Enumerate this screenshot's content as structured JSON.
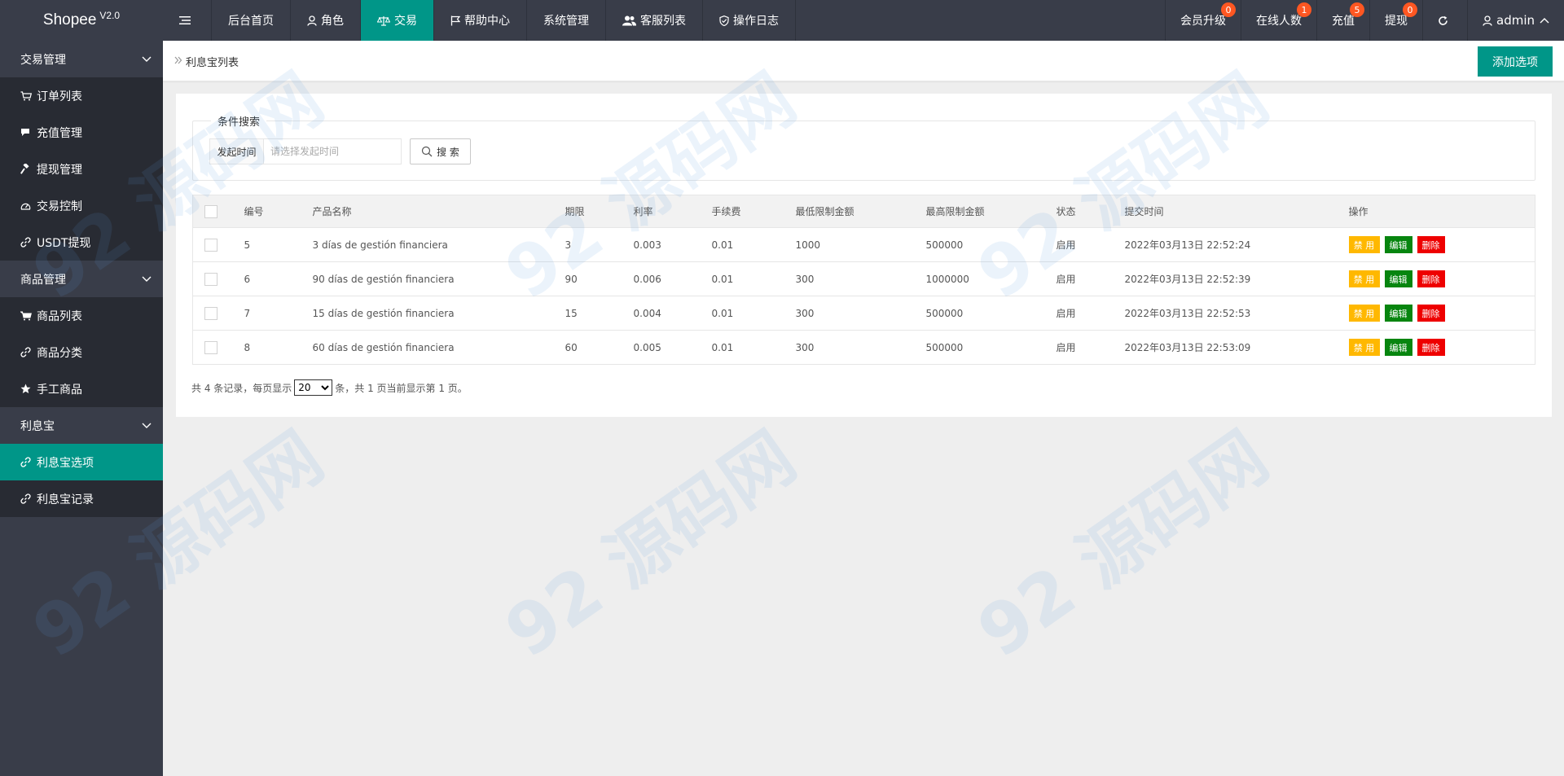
{
  "header": {
    "logo": "Shopee",
    "version": "V2.0",
    "nav": [
      {
        "label": "后台首页",
        "icon": "none"
      },
      {
        "label": "角色",
        "icon": "user-icon"
      },
      {
        "label": "交易",
        "icon": "scale-icon",
        "active": true
      },
      {
        "label": "帮助中心",
        "icon": "flag-icon"
      },
      {
        "label": "系统管理",
        "icon": "none"
      },
      {
        "label": "客服列表",
        "icon": "users-icon"
      },
      {
        "label": "操作日志",
        "icon": "shield-icon"
      }
    ],
    "right": [
      {
        "label": "会员升级",
        "badge": "0"
      },
      {
        "label": "在线人数",
        "badge": "1"
      },
      {
        "label": "充值",
        "badge": "5"
      },
      {
        "label": "提现",
        "badge": "0"
      }
    ],
    "user": "admin",
    "badge_color": "#ff5722"
  },
  "sidebar": {
    "groups": [
      {
        "label": "交易管理",
        "items": [
          {
            "label": "订单列表",
            "icon": "cart-icon"
          },
          {
            "label": "充值管理",
            "icon": "chat-icon"
          },
          {
            "label": "提现管理",
            "icon": "hammer-icon"
          },
          {
            "label": "交易控制",
            "icon": "gauge-icon"
          },
          {
            "label": "USDT提现",
            "icon": "link-icon"
          }
        ]
      },
      {
        "label": "商品管理",
        "items": [
          {
            "label": "商品列表",
            "icon": "cart-icon"
          },
          {
            "label": "商品分类",
            "icon": "link-icon"
          },
          {
            "label": "手工商品",
            "icon": "star-icon"
          }
        ]
      },
      {
        "label": "利息宝",
        "items": [
          {
            "label": "利息宝选项",
            "icon": "link-icon",
            "active": true
          },
          {
            "label": "利息宝记录",
            "icon": "link-icon"
          }
        ]
      }
    ]
  },
  "main": {
    "breadcrumb": "利息宝列表",
    "add_button": "添加选项",
    "search": {
      "legend": "条件搜索",
      "label": "发起时间",
      "placeholder": "请选择发起时间",
      "button": "搜 索"
    },
    "table": {
      "headers": [
        "编号",
        "产品名称",
        "期限",
        "利率",
        "手续费",
        "最低限制金额",
        "最高限制金额",
        "状态",
        "提交时间",
        "操作"
      ],
      "rows": [
        {
          "id": "5",
          "name": "3 días de gestión financiera",
          "term": "3",
          "rate": "0.003",
          "fee": "0.01",
          "min": "1000",
          "max": "500000",
          "status": "启用",
          "time": "2022年03月13日 22:52:24"
        },
        {
          "id": "6",
          "name": "90 días de gestión financiera",
          "term": "90",
          "rate": "0.006",
          "fee": "0.01",
          "min": "300",
          "max": "1000000",
          "status": "启用",
          "time": "2022年03月13日 22:52:39"
        },
        {
          "id": "7",
          "name": "15 días de gestión financiera",
          "term": "15",
          "rate": "0.004",
          "fee": "0.01",
          "min": "300",
          "max": "500000",
          "status": "启用",
          "time": "2022年03月13日 22:52:53"
        },
        {
          "id": "8",
          "name": "60 días de gestión financiera",
          "term": "60",
          "rate": "0.005",
          "fee": "0.01",
          "min": "300",
          "max": "500000",
          "status": "启用",
          "time": "2022年03月13日 22:53:09"
        }
      ],
      "actions": {
        "disable": "禁 用",
        "edit": "编辑",
        "delete": "删除"
      }
    },
    "pager": {
      "prefix": "共 4 条记录，每页显示",
      "page_size": "20",
      "suffix": "条，共 1 页当前显示第 1 页。"
    }
  },
  "colors": {
    "header_bg": "#393d49",
    "accent": "#009688",
    "warn": "#ffb800",
    "edit": "#07850f",
    "danger": "#ee0000"
  },
  "watermark": "92 源码网"
}
